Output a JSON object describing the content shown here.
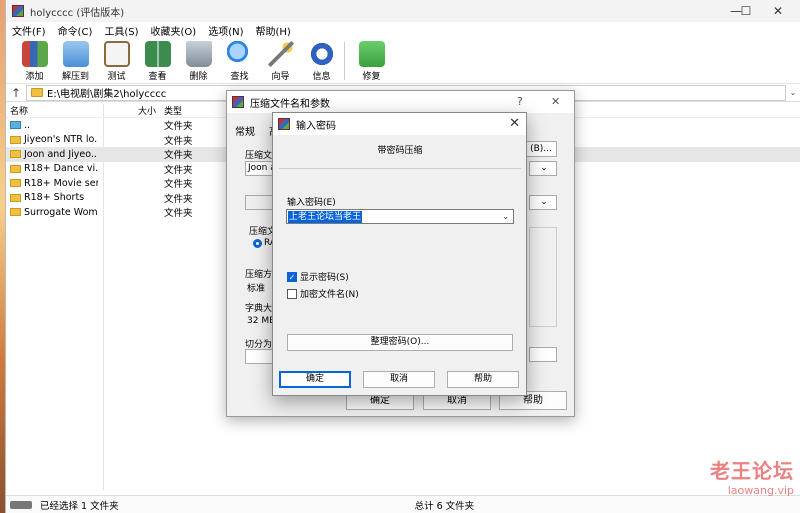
{
  "window": {
    "title": "holycccc (评估版本)",
    "controls": [
      "—",
      "☐",
      "✕"
    ]
  },
  "menu": [
    "文件(F)",
    "命令(C)",
    "工具(S)",
    "收藏夹(O)",
    "选项(N)",
    "帮助(H)"
  ],
  "toolbar": [
    {
      "label": "添加",
      "icon": "add-books-icon",
      "color": "#c8463c"
    },
    {
      "label": "解压到",
      "icon": "extract-folder-icon",
      "color": "#4a8fd8"
    },
    {
      "label": "测试",
      "icon": "test-clipboard-icon",
      "color": "#c0392b"
    },
    {
      "label": "查看",
      "icon": "view-book-icon",
      "color": "#3c8c50"
    },
    {
      "label": "删除",
      "icon": "delete-bin-icon",
      "color": "#7f8c9a"
    },
    {
      "label": "查找",
      "icon": "find-magnifier-icon",
      "color": "#2e86de"
    },
    {
      "label": "向导",
      "icon": "wizard-wand-icon",
      "color": "#7a7a7a"
    },
    {
      "label": "信息",
      "icon": "info-icon",
      "color": "#3060c0"
    },
    {
      "label": "修复",
      "icon": "repair-kit-icon",
      "color": "#3aa040"
    }
  ],
  "address": {
    "path": "E:\\电视剧\\剧集2\\holycccc"
  },
  "columns": {
    "name": "名称",
    "size": "大小",
    "type": "类型"
  },
  "files": [
    {
      "name": "..",
      "size": "",
      "type": "文件夹",
      "up": true
    },
    {
      "name": "Jiyeon's NTR lo...",
      "size": "",
      "type": "文件夹"
    },
    {
      "name": "Joon and Jiyeo...",
      "size": "",
      "type": "文件夹",
      "selected": true
    },
    {
      "name": "R18+ Dance vi...",
      "size": "",
      "type": "文件夹"
    },
    {
      "name": "R18+ Movie ser...",
      "size": "",
      "type": "文件夹"
    },
    {
      "name": "R18+ Shorts",
      "size": "",
      "type": "文件夹"
    },
    {
      "name": "Surrogate Womb",
      "size": "",
      "type": "文件夹"
    }
  ],
  "status": {
    "left": "已经选择 1 文件夹",
    "right": "总计 6 文件夹"
  },
  "archive_dialog": {
    "title": "压缩文件名和参数",
    "help": "?",
    "close": "✕",
    "tab_general": "常规",
    "tab_advanced": "高",
    "label_archive": "压缩文",
    "archive_value": "Joon a",
    "browse_button": "(B)...",
    "label_format": "压缩文",
    "format_value": "RA",
    "label_method": "压缩方",
    "method_value": "标准",
    "label_dict": "字典大小",
    "dict_value": "32 MB",
    "label_split": "切分为",
    "ok": "确定",
    "cancel": "取消",
    "help_button": "帮助"
  },
  "password_dialog": {
    "title": "输入密码",
    "close": "✕",
    "group_title": "带密码压缩",
    "label_password": "输入密码(E)",
    "password_value": "上老王论坛当老王",
    "show_password": "显示密码(S)",
    "encrypt_names": "加密文件名(N)",
    "organize_button": "整理密码(O)...",
    "ok": "确定",
    "cancel": "取消",
    "help": "帮助"
  },
  "watermark": {
    "line1": "老王论坛",
    "line2": "laowang.vip"
  }
}
